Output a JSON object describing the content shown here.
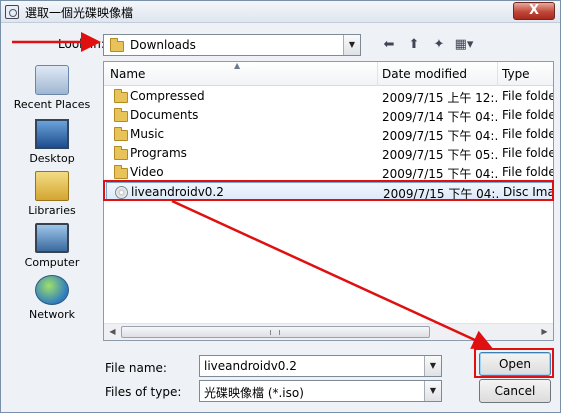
{
  "window": {
    "title": "選取一個光碟映像檔",
    "close_glyph": "X"
  },
  "look_in": {
    "label": "Look in:",
    "value": "Downloads"
  },
  "toolbar": {
    "icons": [
      "back-arrow-icon",
      "up-folder-icon",
      "new-folder-icon",
      "view-menu-icon"
    ]
  },
  "places": [
    {
      "label": "Recent Places",
      "icon": "recent-places-icon"
    },
    {
      "label": "Desktop",
      "icon": "desktop-icon"
    },
    {
      "label": "Libraries",
      "icon": "libraries-icon"
    },
    {
      "label": "Computer",
      "icon": "computer-icon"
    },
    {
      "label": "Network",
      "icon": "network-icon"
    }
  ],
  "file_list": {
    "columns": [
      "Name",
      "Date modified",
      "Type"
    ],
    "rows": [
      {
        "name": "Compressed",
        "date": "2009/7/15 上午 12:...",
        "type": "File folder",
        "icon": "folder-icon"
      },
      {
        "name": "Documents",
        "date": "2009/7/14 下午 04:...",
        "type": "File folder",
        "icon": "folder-icon"
      },
      {
        "name": "Music",
        "date": "2009/7/15 下午 04:...",
        "type": "File folder",
        "icon": "folder-icon"
      },
      {
        "name": "Programs",
        "date": "2009/7/15 下午 05:...",
        "type": "File folder",
        "icon": "folder-icon"
      },
      {
        "name": "Video",
        "date": "2009/7/15 下午 04:...",
        "type": "File folder",
        "icon": "folder-icon"
      },
      {
        "name": "liveandroidv0.2",
        "date": "2009/7/15 下午 04:...",
        "type": "Disc Imag",
        "icon": "disc-image-icon",
        "selected": true
      }
    ]
  },
  "file_name": {
    "label": "File name:",
    "value": "liveandroidv0.2"
  },
  "file_type": {
    "label": "Files of type:",
    "value": "光碟映像檔 (*.iso)"
  },
  "buttons": {
    "open": "Open",
    "cancel": "Cancel"
  },
  "colors": {
    "annotation": "#e01010",
    "selection": "#dce9f8"
  }
}
